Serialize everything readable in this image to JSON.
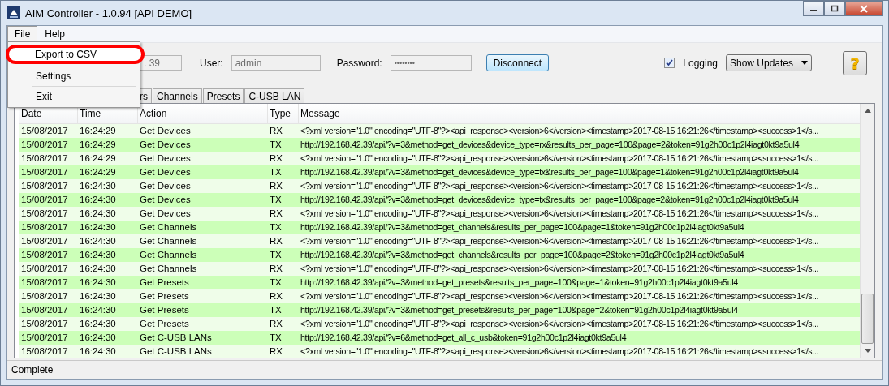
{
  "window": {
    "title": "AIM Controller - 1.0.94   [API DEMO]"
  },
  "menu_bar": [
    {
      "label": "File",
      "selected": true
    },
    {
      "label": "Help",
      "selected": false
    }
  ],
  "file_menu": {
    "items": [
      {
        "label": "Export to CSV",
        "highlighted": true
      },
      {
        "label": "Settings",
        "highlighted": false
      },
      {
        "label": "Exit",
        "highlighted": false
      }
    ]
  },
  "toolbar": {
    "ip_field": {
      "value": ". 39"
    },
    "user": {
      "label": "User:",
      "value": "admin"
    },
    "password": {
      "label": "Password:",
      "value": "••••••••"
    },
    "disconnect_button": "Disconnect",
    "logging": {
      "label": "Logging",
      "checked": true
    },
    "updates_dropdown": "Show Updates",
    "help_button": "?"
  },
  "tabs": [
    {
      "label": "rs",
      "selected": false
    },
    {
      "label": "Channels",
      "selected": false
    },
    {
      "label": "Presets",
      "selected": false
    },
    {
      "label": "C-USB LAN",
      "selected": false
    }
  ],
  "table": {
    "columns": [
      "Date",
      "Time",
      "Action",
      "Type",
      "Message"
    ],
    "rows": [
      {
        "cells": [
          "15/08/2017",
          "16:24:29",
          "Get Devices",
          "RX",
          "<?xml version=\"1.0\" encoding=\"UTF-8\"?><api_response><version>6</version><timestamp>2017-08-15 16:21:26</timestamp><success>1</s..."
        ],
        "highlighted": false
      },
      {
        "cells": [
          "15/08/2017",
          "16:24:29",
          "Get Devices",
          "TX",
          "http://192.168.42.39/api/?v=3&method=get_devices&device_type=rx&results_per_page=100&page=2&token=91g2h00c1p2l4iagt0kt9a5ul4"
        ],
        "highlighted": true
      },
      {
        "cells": [
          "15/08/2017",
          "16:24:29",
          "Get Devices",
          "RX",
          "<?xml version=\"1.0\" encoding=\"UTF-8\"?><api_response><version>6</version><timestamp>2017-08-15 16:21:26</timestamp><success>1</s..."
        ],
        "highlighted": false
      },
      {
        "cells": [
          "15/08/2017",
          "16:24:29",
          "Get Devices",
          "TX",
          "http://192.168.42.39/api/?v=3&method=get_devices&device_type=tx&results_per_page=100&page=1&token=91g2h00c1p2l4iagt0kt9a5ul4"
        ],
        "highlighted": true
      },
      {
        "cells": [
          "15/08/2017",
          "16:24:30",
          "Get Devices",
          "RX",
          "<?xml version=\"1.0\" encoding=\"UTF-8\"?><api_response><version>6</version><timestamp>2017-08-15 16:21:26</timestamp><success>1</s..."
        ],
        "highlighted": false
      },
      {
        "cells": [
          "15/08/2017",
          "16:24:30",
          "Get Devices",
          "TX",
          "http://192.168.42.39/api/?v=3&method=get_devices&device_type=tx&results_per_page=100&page=2&token=91g2h00c1p2l4iagt0kt9a5ul4"
        ],
        "highlighted": true
      },
      {
        "cells": [
          "15/08/2017",
          "16:24:30",
          "Get Devices",
          "RX",
          "<?xml version=\"1.0\" encoding=\"UTF-8\"?><api_response><version>6</version><timestamp>2017-08-15 16:21:26</timestamp><success>1</s..."
        ],
        "highlighted": false
      },
      {
        "cells": [
          "15/08/2017",
          "16:24:30",
          "Get Channels",
          "TX",
          "http://192.168.42.39/api/?v=3&method=get_channels&results_per_page=100&page=1&token=91g2h00c1p2l4iagt0kt9a5ul4"
        ],
        "highlighted": true
      },
      {
        "cells": [
          "15/08/2017",
          "16:24:30",
          "Get Channels",
          "RX",
          "<?xml version=\"1.0\" encoding=\"UTF-8\"?><api_response><version>6</version><timestamp>2017-08-15 16:21:26</timestamp><success>1</s..."
        ],
        "highlighted": false
      },
      {
        "cells": [
          "15/08/2017",
          "16:24:30",
          "Get Channels",
          "TX",
          "http://192.168.42.39/api/?v=3&method=get_channels&results_per_page=100&page=2&token=91g2h00c1p2l4iagt0kt9a5ul4"
        ],
        "highlighted": true
      },
      {
        "cells": [
          "15/08/2017",
          "16:24:30",
          "Get Channels",
          "RX",
          "<?xml version=\"1.0\" encoding=\"UTF-8\"?><api_response><version>6</version><timestamp>2017-08-15 16:21:26</timestamp><success>1</s..."
        ],
        "highlighted": false
      },
      {
        "cells": [
          "15/08/2017",
          "16:24:30",
          "Get Presets",
          "TX",
          "http://192.168.42.39/api/?v=3&method=get_presets&results_per_page=100&page=1&token=91g2h00c1p2l4iagt0kt9a5ul4"
        ],
        "highlighted": true
      },
      {
        "cells": [
          "15/08/2017",
          "16:24:30",
          "Get Presets",
          "RX",
          "<?xml version=\"1.0\" encoding=\"UTF-8\"?><api_response><version>6</version><timestamp>2017-08-15 16:21:26</timestamp><success>1</s..."
        ],
        "highlighted": false
      },
      {
        "cells": [
          "15/08/2017",
          "16:24:30",
          "Get Presets",
          "TX",
          "http://192.168.42.39/api/?v=3&method=get_presets&results_per_page=100&page=2&token=91g2h00c1p2l4iagt0kt9a5ul4"
        ],
        "highlighted": true
      },
      {
        "cells": [
          "15/08/2017",
          "16:24:30",
          "Get Presets",
          "RX",
          "<?xml version=\"1.0\" encoding=\"UTF-8\"?><api_response><version>6</version><timestamp>2017-08-15 16:21:26</timestamp><success>1</s..."
        ],
        "highlighted": false
      },
      {
        "cells": [
          "15/08/2017",
          "16:24:30",
          "Get C-USB LANs",
          "TX",
          "http://192.168.42.39/api/?v=6&method=get_all_c_usb&token=91g2h00c1p2l4iagt0kt9a5ul4"
        ],
        "highlighted": true
      },
      {
        "cells": [
          "15/08/2017",
          "16:24:30",
          "Get C-USB LANs",
          "RX",
          "<?xml version=\"1.0\" encoding=\"UTF-8\"?><api_response><version>6</version><timestamp>2017-08-15 16:21:26</timestamp><success>1</s..."
        ],
        "highlighted": false
      }
    ]
  },
  "status_bar": "Complete"
}
